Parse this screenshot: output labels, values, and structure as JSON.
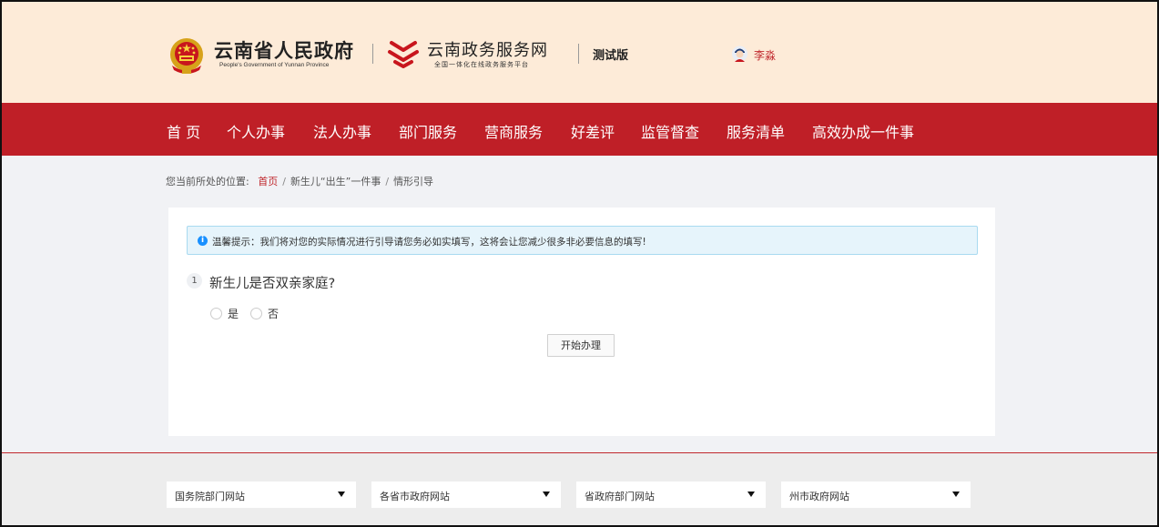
{
  "header": {
    "gov_title": "云南省人民政府",
    "gov_subtitle": "People's Government of Yunnan Province",
    "service_title": "云南政务服务网",
    "service_subtitle": "全国一体化在线政务服务平台",
    "edition_label": "测试版",
    "user_name": "李淼"
  },
  "nav": {
    "items": [
      {
        "label": "首 页"
      },
      {
        "label": "个人办事"
      },
      {
        "label": "法人办事"
      },
      {
        "label": "部门服务"
      },
      {
        "label": "营商服务"
      },
      {
        "label": "好差评"
      },
      {
        "label": "监管督查"
      },
      {
        "label": "服务清单"
      },
      {
        "label": "高效办成一件事"
      }
    ]
  },
  "breadcrumb": {
    "prefix": "您当前所处的位置:",
    "items": [
      "首页",
      "新生儿“出生”一件事",
      "情形引导"
    ],
    "divider": "/"
  },
  "tip": {
    "icon": "info-icon",
    "text": "温馨提示：我们将对您的实际情况进行引导请您务必如实填写，这将会让您减少很多非必要信息的填写!"
  },
  "question": {
    "number": "1",
    "text": "新生儿是否双亲家庭?",
    "options": [
      {
        "label": "是",
        "selected": false
      },
      {
        "label": "否",
        "selected": false
      }
    ]
  },
  "start_button": {
    "label": "开始办理"
  },
  "footer": {
    "selects": [
      {
        "label": "国务院部门网站"
      },
      {
        "label": "各省市政府网站"
      },
      {
        "label": "省政府部门网站"
      },
      {
        "label": "州市政府网站"
      }
    ]
  },
  "colors": {
    "nav_red": "#bf1f27",
    "header_bg": "#fdebd8",
    "accent_red": "#c0282d",
    "tip_bg": "#e6f4fb",
    "info_blue": "#1890ff"
  }
}
